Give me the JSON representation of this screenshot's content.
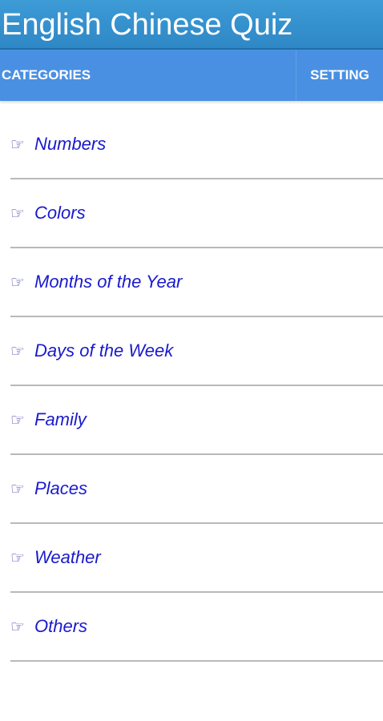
{
  "app": {
    "title": "English Chinese Quiz"
  },
  "tabs": [
    {
      "label": "CATEGORIES"
    },
    {
      "label": "SETTING"
    }
  ],
  "icons": {
    "item_icon": "pointing-hand-icon",
    "item_glyph": "☞"
  },
  "colors": {
    "title_bar": "#2e88c6",
    "tab_bar": "#4a90e2",
    "item_text": "#1a1acc"
  },
  "categories": [
    {
      "label": "Numbers"
    },
    {
      "label": "Colors"
    },
    {
      "label": "Months of the Year"
    },
    {
      "label": "Days of the Week"
    },
    {
      "label": "Family"
    },
    {
      "label": "Places"
    },
    {
      "label": "Weather"
    },
    {
      "label": "Others"
    }
  ]
}
